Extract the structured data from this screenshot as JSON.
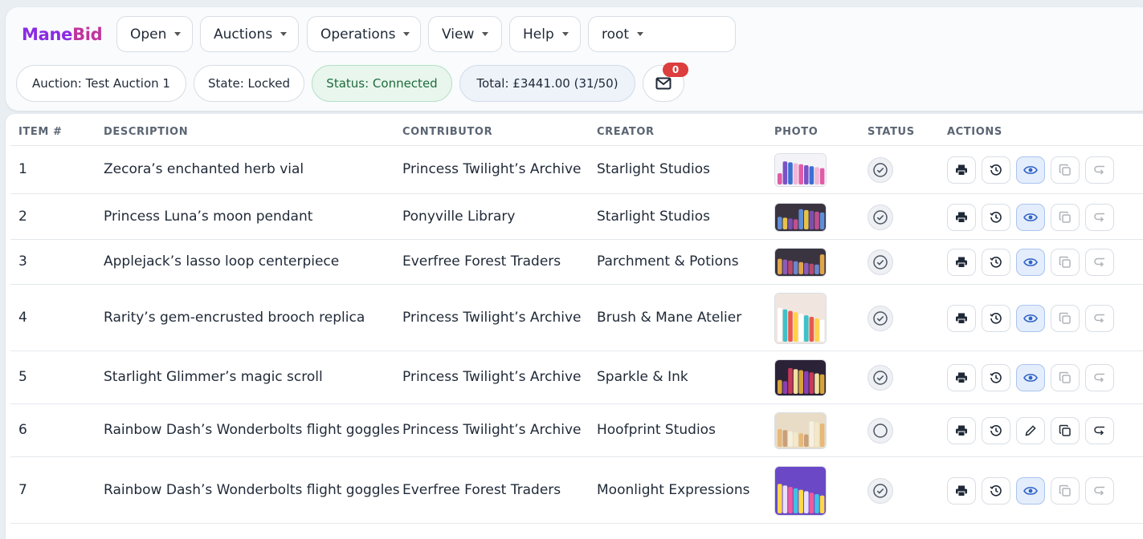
{
  "app": {
    "logo_part1": "Mane",
    "logo_part2": "Bid"
  },
  "menus": [
    {
      "label": "Open"
    },
    {
      "label": "Auctions"
    },
    {
      "label": "Operations"
    },
    {
      "label": "View"
    },
    {
      "label": "Help"
    },
    {
      "label": "root"
    }
  ],
  "status_bar": {
    "auction": "Auction: Test Auction 1",
    "state": "State: Locked",
    "connection": "Status: Connected",
    "total": "Total: £3441.00 (31/50)",
    "messages_count": "0"
  },
  "table": {
    "columns": [
      "ITEM #",
      "DESCRIPTION",
      "CONTRIBUTOR",
      "CREATOR",
      "PHOTO",
      "STATUS",
      "ACTIONS"
    ],
    "rows": [
      {
        "item": "1",
        "description": "Zecora’s enchanted herb vial",
        "contributor": "Princess Twilight’s Archive",
        "creator": "Starlight Studios",
        "status": "checked",
        "editable": false
      },
      {
        "item": "2",
        "description": "Princess Luna’s moon pendant",
        "contributor": "Ponyville Library",
        "creator": "Starlight Studios",
        "status": "checked",
        "editable": false
      },
      {
        "item": "3",
        "description": "Applejack’s lasso loop centerpiece",
        "contributor": "Everfree Forest Traders",
        "creator": "Parchment & Potions",
        "status": "checked",
        "editable": false
      },
      {
        "item": "4",
        "description": "Rarity’s gem-encrusted brooch replica",
        "contributor": "Princess Twilight’s Archive",
        "creator": "Brush & Mane Atelier",
        "status": "checked",
        "editable": false
      },
      {
        "item": "5",
        "description": "Starlight Glimmer’s magic scroll",
        "contributor": "Princess Twilight’s Archive",
        "creator": "Sparkle & Ink",
        "status": "checked",
        "editable": false
      },
      {
        "item": "6",
        "description": "Rainbow Dash’s Wonderbolts flight goggles",
        "contributor": "Princess Twilight’s Archive",
        "creator": "Hoofprint Studios",
        "status": "unchecked",
        "editable": true
      },
      {
        "item": "7",
        "description": "Rainbow Dash’s Wonderbolts flight goggles",
        "contributor": "Everfree Forest Traders",
        "creator": "Moonlight Expressions",
        "status": "checked",
        "editable": false
      }
    ]
  },
  "colors": {
    "brand_start": "#8a2be2",
    "brand_end": "#c0359c",
    "connected_bg": "#e8f6ee",
    "connected_text": "#1e6b3a",
    "badge": "#dc3d3d",
    "view_active_bg": "#e4edfb"
  },
  "icons": [
    "print-icon",
    "history-icon",
    "eye-icon",
    "edit-icon",
    "copy-icon",
    "return-icon",
    "check-circle-icon",
    "empty-circle-icon",
    "mail-icon",
    "chevron-down-icon"
  ]
}
